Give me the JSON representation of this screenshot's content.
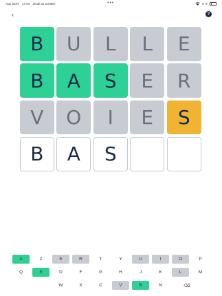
{
  "status_bar": {
    "carrier": "App Store",
    "time": "17:54",
    "date": "Jeudi 31 octobre",
    "dots": "•••",
    "battery": "6 %"
  },
  "header": {
    "back_icon": "chevron-left-icon",
    "help_icon": "question-circle-icon",
    "help_label": "?",
    "back_label": "‹"
  },
  "colors": {
    "correct": "#2dd196",
    "absent": "#c9cbd3",
    "present": "#f0b432",
    "text": "#1c2b4a"
  },
  "board": {
    "rows": [
      {
        "tiles": [
          {
            "letter": "B",
            "state": "correct"
          },
          {
            "letter": "U",
            "state": "absent"
          },
          {
            "letter": "L",
            "state": "absent"
          },
          {
            "letter": "L",
            "state": "absent"
          },
          {
            "letter": "E",
            "state": "absent"
          }
        ]
      },
      {
        "tiles": [
          {
            "letter": "B",
            "state": "correct"
          },
          {
            "letter": "A",
            "state": "correct"
          },
          {
            "letter": "S",
            "state": "correct"
          },
          {
            "letter": "E",
            "state": "absent"
          },
          {
            "letter": "R",
            "state": "absent"
          }
        ]
      },
      {
        "tiles": [
          {
            "letter": "V",
            "state": "absent"
          },
          {
            "letter": "O",
            "state": "absent"
          },
          {
            "letter": "I",
            "state": "absent"
          },
          {
            "letter": "E",
            "state": "absent"
          },
          {
            "letter": "S",
            "state": "present"
          }
        ]
      },
      {
        "tiles": [
          {
            "letter": "B",
            "state": "typed"
          },
          {
            "letter": "A",
            "state": "typed"
          },
          {
            "letter": "S",
            "state": "typed"
          },
          {
            "letter": "",
            "state": "empty"
          },
          {
            "letter": "",
            "state": "empty"
          }
        ]
      }
    ]
  },
  "keyboard": {
    "rows": [
      [
        {
          "label": "A",
          "state": "correct"
        },
        {
          "label": "Z",
          "state": "unused"
        },
        {
          "label": "E",
          "state": "absent"
        },
        {
          "label": "R",
          "state": "absent"
        },
        {
          "label": "T",
          "state": "unused"
        },
        {
          "label": "Y",
          "state": "unused"
        },
        {
          "label": "U",
          "state": "absent"
        },
        {
          "label": "I",
          "state": "absent"
        },
        {
          "label": "O",
          "state": "absent"
        },
        {
          "label": "P",
          "state": "unused"
        }
      ],
      [
        {
          "label": "Q",
          "state": "unused"
        },
        {
          "label": "S",
          "state": "correct"
        },
        {
          "label": "D",
          "state": "unused"
        },
        {
          "label": "F",
          "state": "unused"
        },
        {
          "label": "G",
          "state": "unused"
        },
        {
          "label": "H",
          "state": "unused"
        },
        {
          "label": "J",
          "state": "unused"
        },
        {
          "label": "K",
          "state": "unused"
        },
        {
          "label": "L",
          "state": "absent"
        },
        {
          "label": "M",
          "state": "unused"
        }
      ],
      [
        {
          "label": "W",
          "state": "unused"
        },
        {
          "label": "X",
          "state": "unused"
        },
        {
          "label": "C",
          "state": "unused"
        },
        {
          "label": "V",
          "state": "absent"
        },
        {
          "label": "B",
          "state": "correct"
        },
        {
          "label": "N",
          "state": "unused"
        },
        {
          "label": "⌫",
          "state": "unused",
          "icon": "backspace-icon"
        }
      ]
    ]
  }
}
